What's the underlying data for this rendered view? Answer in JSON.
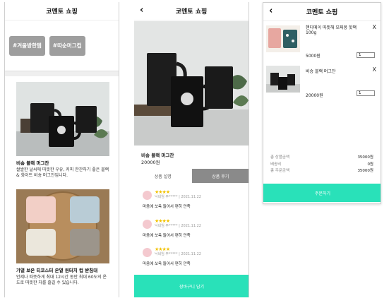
{
  "shop_title": "코멘토 쇼핑",
  "list_page": {
    "tags": [
      "#겨울방한템",
      "#따순머그컵"
    ],
    "products": [
      {
        "name": "비숑 블랙 머그잔",
        "desc": "쌀쌀한 날씨에 따뜻한 우유, 커피 한잔하기 좋은 블랙 & 화이트 비숑 머그잔입니다."
      },
      {
        "name": "가열 보온 티코스터 온열 원터치 컵 받침대",
        "desc": "언제나 따뜻하게 최대 12시간 동안 최대 60도의 온도로 따뜻한 차를 즐길 수 있습니다."
      }
    ]
  },
  "detail_page": {
    "product_name": "비숑 블랙 머그잔",
    "price": "20000원",
    "tabs": [
      "상품 설명",
      "상품 후기"
    ],
    "reviews": [
      {
        "stars": "★★★★",
        "meta": "닉네임 주***** | 2021.11.22",
        "text": "마음에 쏘옥 들어서 편히 만족"
      },
      {
        "stars": "★★★★",
        "meta": "닉네임 주***** | 2021.11.22",
        "text": "마음에 쏘옥 들어서 편히 만족"
      },
      {
        "stars": "★★★★",
        "meta": "닉네임 주***** | 2021.11.22",
        "text": "마음에 쏘옥 들어서 편히 만족"
      }
    ],
    "cta_label": "장바구니 담기"
  },
  "cart_page": {
    "items": [
      {
        "name": "핸디메이 따뜻해 모찌몽 핫팩 100g",
        "price": "5000원",
        "qty": "1"
      },
      {
        "name": "비숑 블랙 머그잔",
        "price": "20000원",
        "qty": "1"
      }
    ],
    "close_glyph": "X",
    "totals": [
      {
        "label": "총 상품금액",
        "value": "35000원"
      },
      {
        "label": "배송비",
        "value": "0원"
      },
      {
        "label": "총 주문금액",
        "value": "35000원"
      }
    ],
    "order_label": "주문하기"
  },
  "colors": {
    "accent": "#29e1b9",
    "tag_bg": "#9e9e9e",
    "tab_active": "#8a8a8a",
    "star": "#f2c200"
  }
}
